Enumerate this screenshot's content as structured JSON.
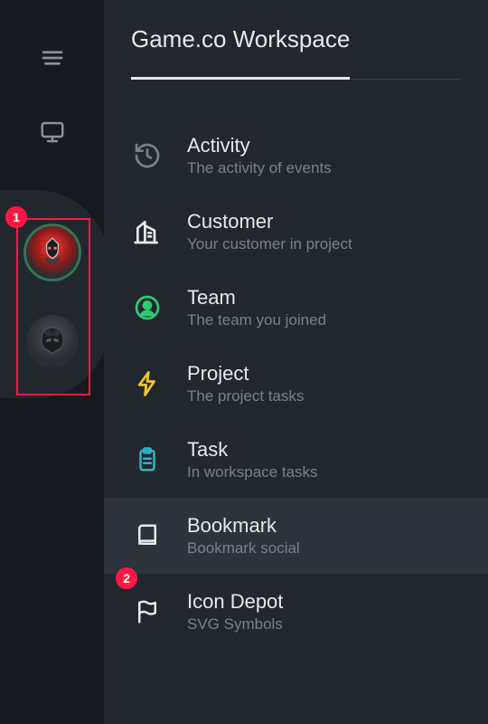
{
  "header": {
    "title": "Game.co Workspace"
  },
  "nav": {
    "items": [
      {
        "label": "Activity",
        "sub": "The activity of events"
      },
      {
        "label": "Customer",
        "sub": "Your customer in project"
      },
      {
        "label": "Team",
        "sub": "The team you joined"
      },
      {
        "label": "Project",
        "sub": "The project tasks"
      },
      {
        "label": "Task",
        "sub": "In workspace tasks"
      },
      {
        "label": "Bookmark",
        "sub": "Bookmark social"
      },
      {
        "label": "Icon Depot",
        "sub": "SVG Symbols"
      }
    ]
  },
  "annotations": {
    "badge1": "1",
    "badge2": "2"
  }
}
